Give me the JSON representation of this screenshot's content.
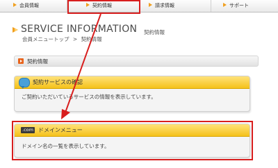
{
  "nav": {
    "tabs": [
      {
        "label": "会員情報"
      },
      {
        "label": "契約情報"
      },
      {
        "label": "請求情報"
      },
      {
        "label": "サポート"
      }
    ]
  },
  "header": {
    "title": "SERVICE INFORMATION",
    "subtitle": "契約情報",
    "breadcrumb_home": "会員メニュートップ",
    "breadcrumb_sep": ">",
    "breadcrumb_current": "契約情報"
  },
  "section": {
    "title": "契約情報"
  },
  "cards": [
    {
      "title": "契約サービスの確認",
      "description": "ご契約いただいているサービスの情報を表示しています。",
      "icon": "speech-bubble-icon"
    },
    {
      "tag": ".com",
      "title": "ドメインメニュー",
      "description": "ドメイン名の一覧を表示しています。",
      "icon": "dotcom-icon"
    }
  ],
  "colors": {
    "accent_orange": "#f0a020",
    "card_header": "#f5c21b",
    "highlight_red": "#d81e1e"
  }
}
